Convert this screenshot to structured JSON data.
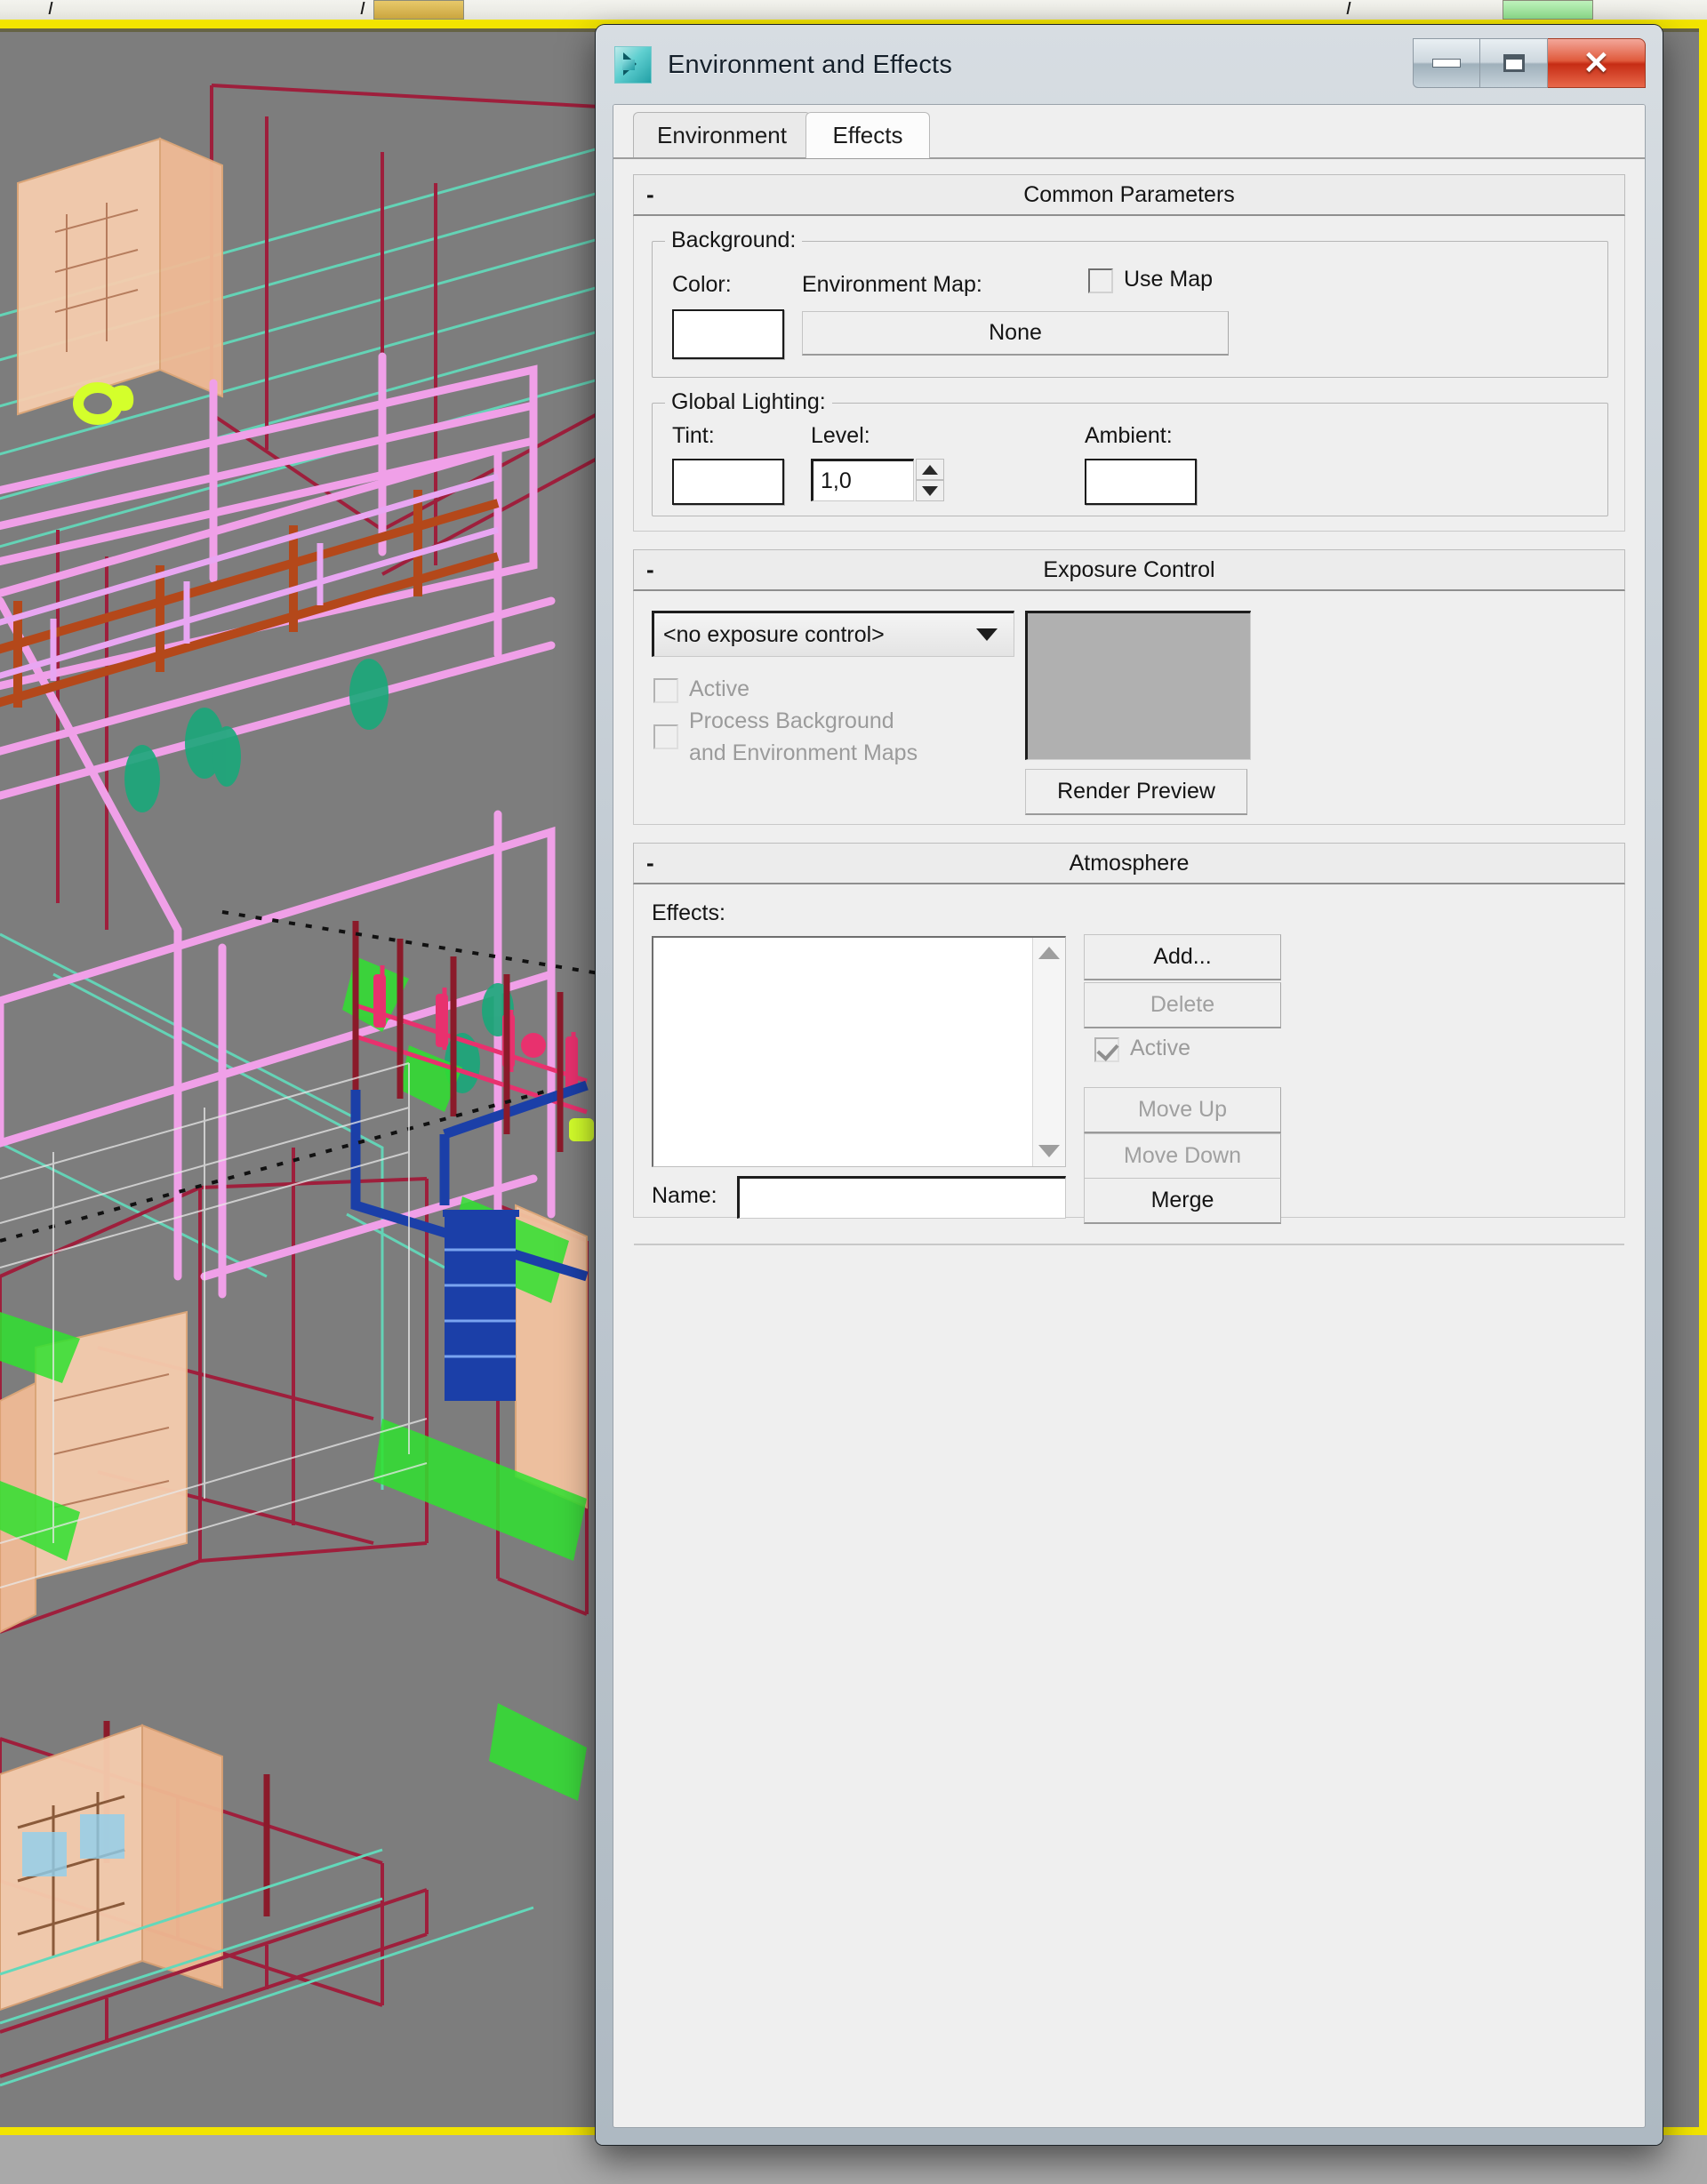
{
  "window": {
    "title": "Environment and Effects",
    "icon": "max-environment-icon",
    "buttons": {
      "minimize": "minimize-icon",
      "maximize": "maximize-icon",
      "close": "close-icon"
    }
  },
  "tabs": [
    {
      "label": "Environment",
      "active": false
    },
    {
      "label": "Effects",
      "active": true
    }
  ],
  "rollouts": {
    "common_parameters": {
      "title": "Common Parameters",
      "collapse_glyph": "-",
      "background": {
        "group_label": "Background:",
        "color_label": "Color:",
        "color_value": "#ffffff",
        "environment_map_label": "Environment Map:",
        "environment_map_button": "None",
        "use_map_label": "Use Map",
        "use_map_checked": false
      },
      "global_lighting": {
        "group_label": "Global Lighting:",
        "tint_label": "Tint:",
        "tint_value": "#ffffff",
        "level_label": "Level:",
        "level_value": "1,0",
        "ambient_label": "Ambient:",
        "ambient_value": "#ffffff"
      }
    },
    "exposure_control": {
      "title": "Exposure Control",
      "collapse_glyph": "-",
      "selected_control": "<no exposure control>",
      "active_label": "Active",
      "active_checked": false,
      "active_enabled": false,
      "process_bg_label_line1": "Process Background",
      "process_bg_label_line2": "and Environment Maps",
      "process_bg_checked": false,
      "process_bg_enabled": false,
      "render_preview_button": "Render Preview",
      "preview_color": "#b0b0b0"
    },
    "atmosphere": {
      "title": "Atmosphere",
      "collapse_glyph": "-",
      "effects_label": "Effects:",
      "effects_items": [],
      "buttons": {
        "add": "Add...",
        "delete": "Delete",
        "active": "Active",
        "move_up": "Move Up",
        "move_down": "Move Down",
        "merge": "Merge"
      },
      "active_checked": true,
      "active_enabled": false,
      "delete_enabled": false,
      "move_up_enabled": false,
      "move_down_enabled": false,
      "name_label": "Name:",
      "name_value": ""
    }
  },
  "viewport": {
    "name": "perspective-wireframe-viewport",
    "background_color": "#7d7d7d",
    "active_border_color": "#f2e400",
    "wire_colors": {
      "crimson": "#9e1f3c",
      "teal": "#63d8ba",
      "pink": "#f0a0e8",
      "violet": "#e8a6f2",
      "peach": "#f4c8a6",
      "green": "#2fe02f",
      "blue": "#1b3fa8",
      "magenta": "#e8316e",
      "orange": "#b4481a",
      "yellow": "#d4ff2b",
      "seagreen": "#1aa87a"
    }
  }
}
